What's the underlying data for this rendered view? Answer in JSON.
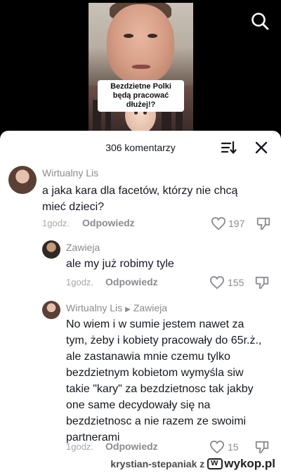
{
  "video": {
    "caption": "Bezdzietne Polki będą pracować dłużej!?"
  },
  "sheet": {
    "comment_count": "306 komentarzy"
  },
  "comments": [
    {
      "author": "Wirtualny Lis",
      "text": "a jaka kara dla facetów, którzy nie chcą mieć dzieci?",
      "time": "1godz.",
      "reply_label": "Odpowiedz",
      "likes": "197"
    },
    {
      "author": "Zawieja",
      "text": "ale my już robimy tyle",
      "time": "1godz.",
      "reply_label": "Odpowiedz",
      "likes": "155"
    },
    {
      "author": "Wirtualny Lis",
      "reply_to": "Zawieja",
      "text": "No wiem i w sumie jestem nawet za tym, żeby i kobiety pracowały do 65r.ż., ale zastanawia mnie czemu tylko bezdzietnym kobietom wymyśla siw takie \"kary\" za bezdzietnosc tak jakby one same decydowały się na bezdzietnosc a nie razem ze swoimi partnerami",
      "time": "1godz.",
      "reply_label": "Odpowiedz",
      "likes": "15"
    }
  ],
  "watermark": {
    "user": "krystian-stepaniak",
    "connector": "z",
    "site": "wykop.pl"
  }
}
